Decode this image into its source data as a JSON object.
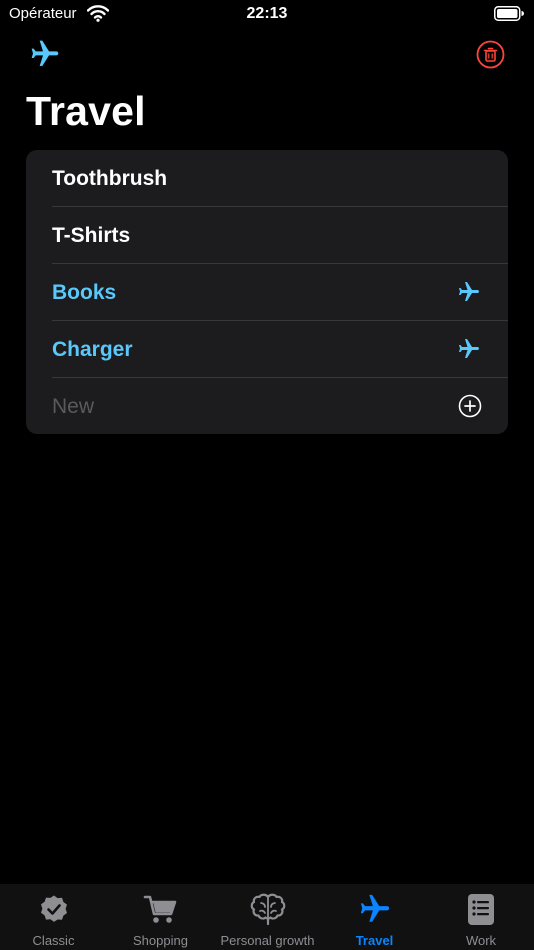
{
  "status": {
    "carrier": "Opérateur",
    "time": "22:13"
  },
  "header": {
    "title": "Travel"
  },
  "list": {
    "items": [
      {
        "label": "Toothbrush",
        "marked": false
      },
      {
        "label": "T-Shirts",
        "marked": false
      },
      {
        "label": "Books",
        "marked": true
      },
      {
        "label": "Charger",
        "marked": true
      }
    ],
    "new_placeholder": "New"
  },
  "tabs": [
    {
      "label": "Classic",
      "icon": "checkmark-seal-icon"
    },
    {
      "label": "Shopping",
      "icon": "cart-icon"
    },
    {
      "label": "Personal growth",
      "icon": "brain-icon"
    },
    {
      "label": "Travel",
      "icon": "airplane-icon",
      "active": true
    },
    {
      "label": "Work",
      "icon": "note-list-icon"
    }
  ],
  "colors": {
    "accent": "#0a84ff",
    "marked": "#5ac8fa",
    "danger": "#ff453a",
    "inactive": "#8e8e93"
  }
}
